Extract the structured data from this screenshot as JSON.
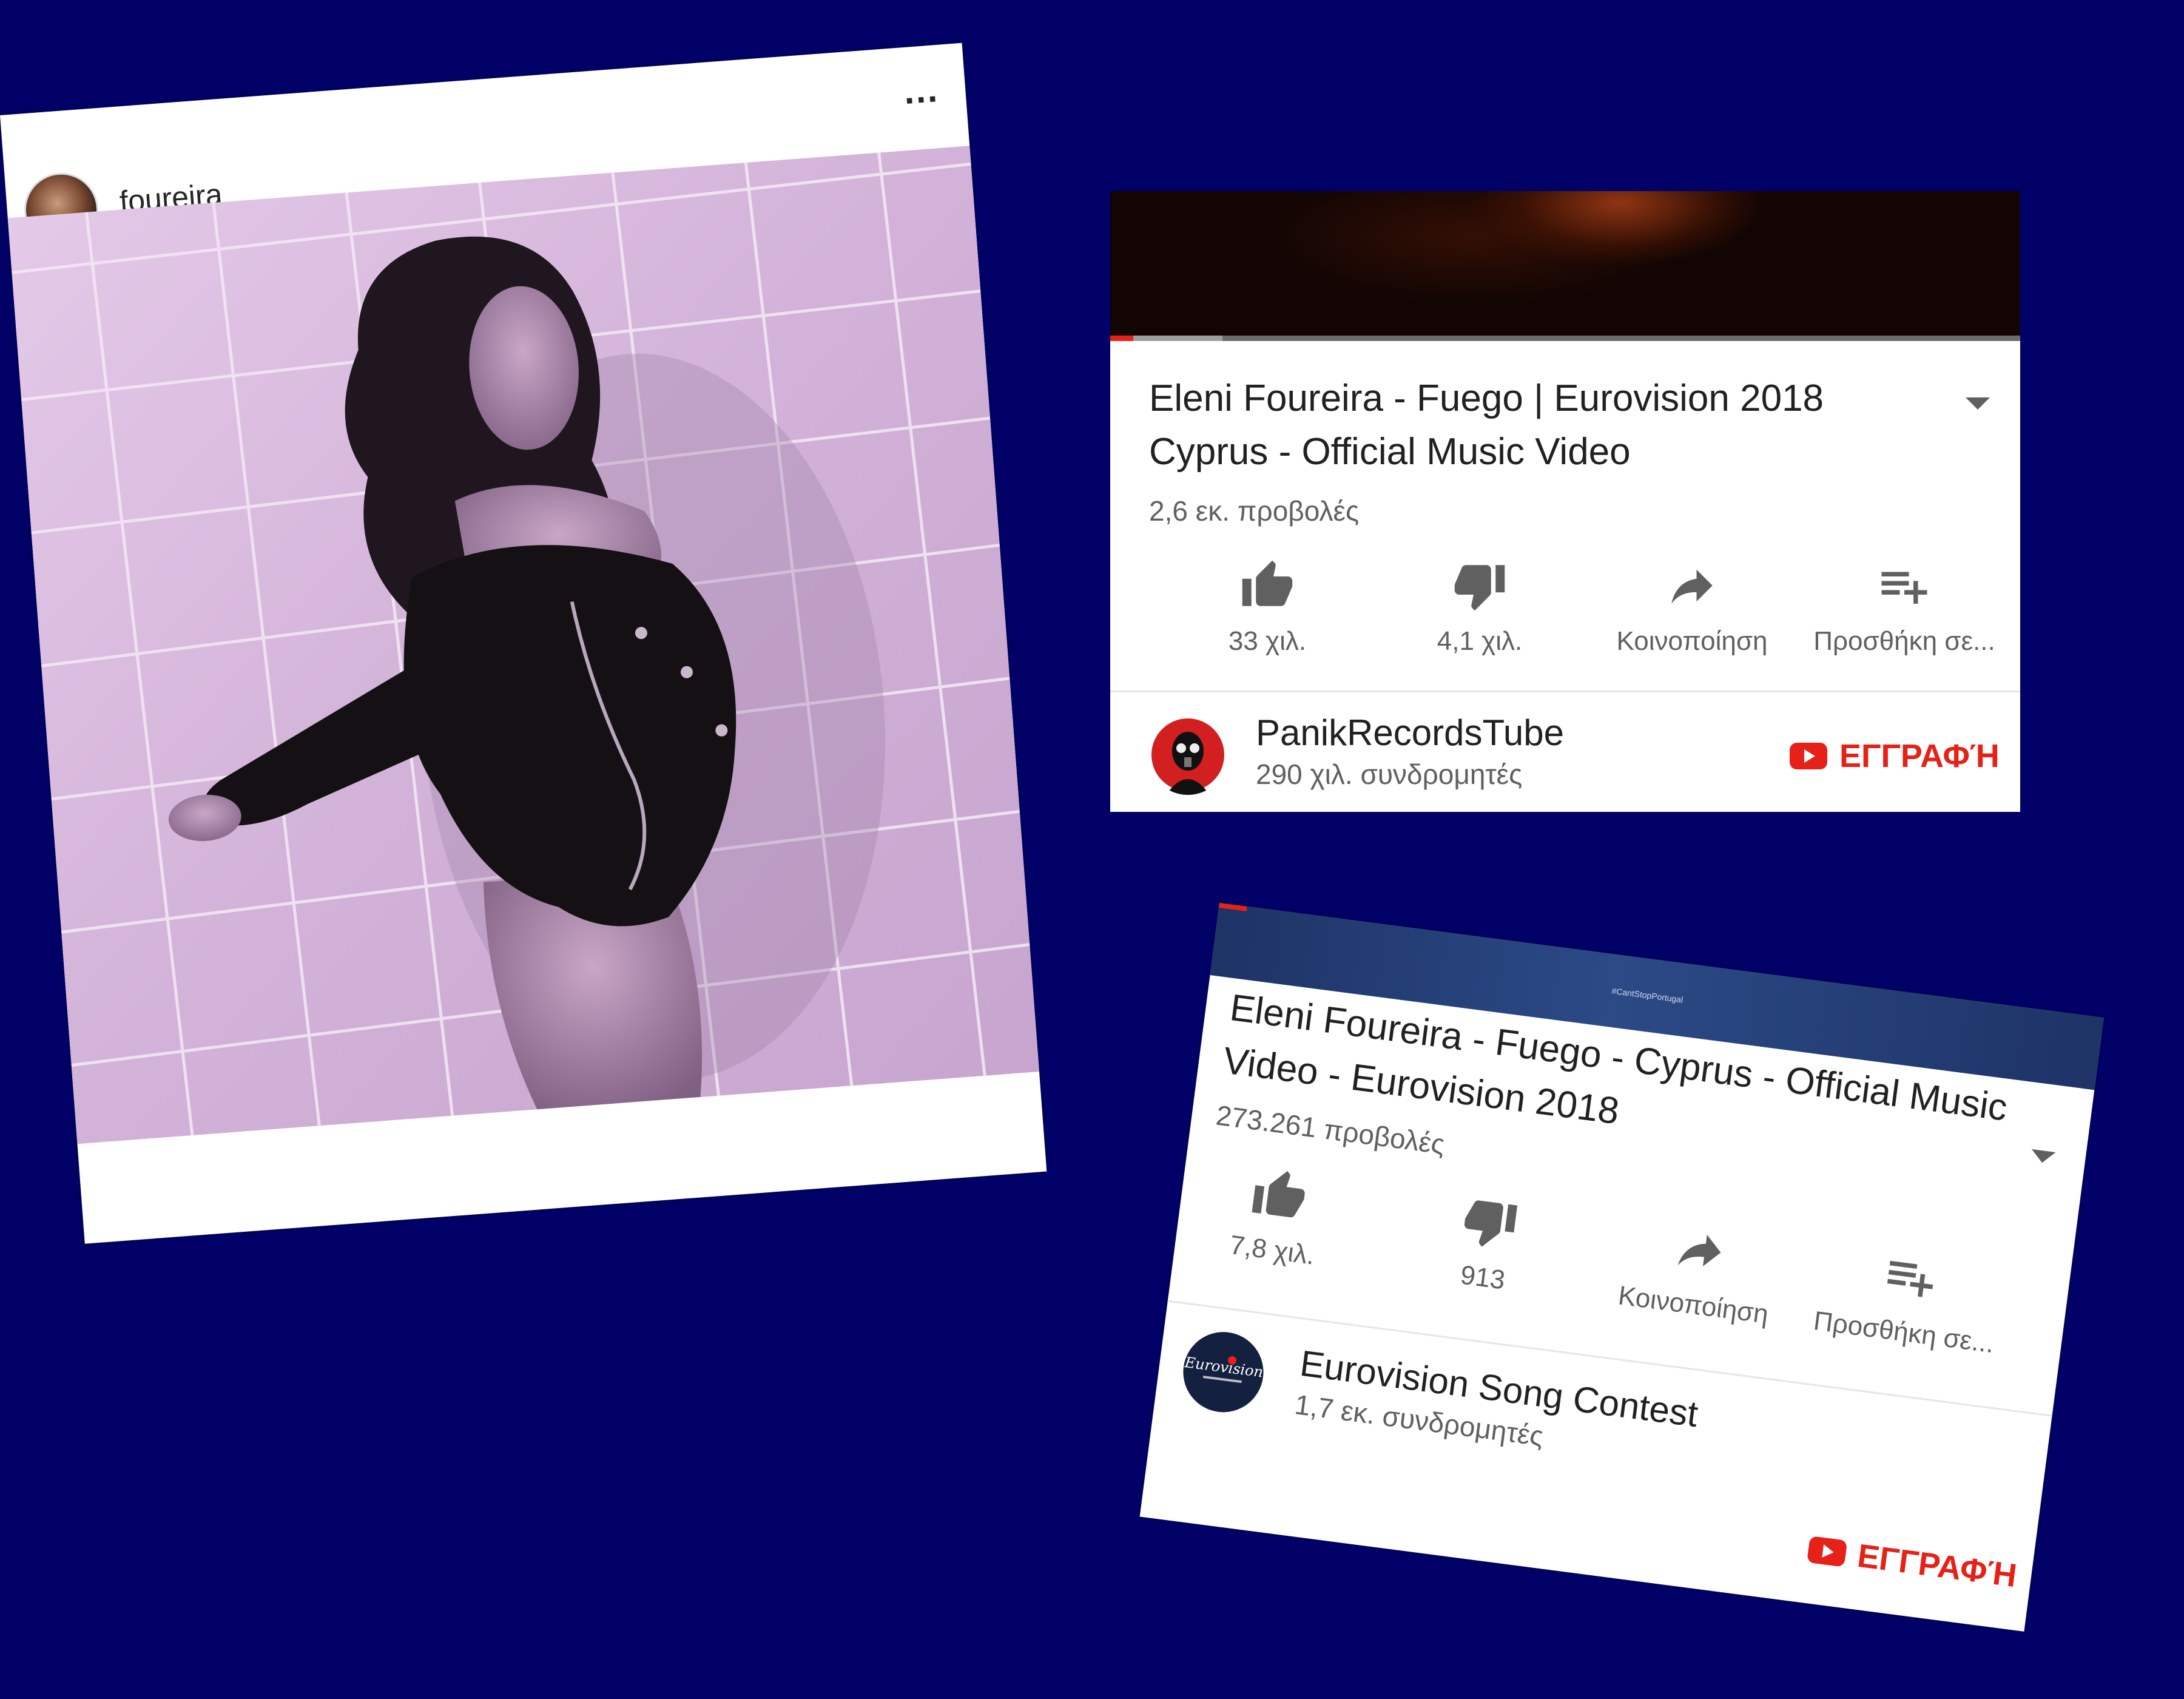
{
  "colors": {
    "background": "#000066",
    "youtube_red": "#e62117",
    "instagram_text": "#262626",
    "muted_text": "#606060"
  },
  "instagram": {
    "username": "foureira",
    "more_icon": "…",
    "icons": {
      "avatar": "profile-avatar",
      "more": "more-options-icon"
    }
  },
  "youtube_1": {
    "title_line1": "Eleni Foureira - Fuego | Eurovision 2018",
    "title_line2": "Cyprus - Official Music Video",
    "views": "2,6 εκ. προβολές",
    "likes": "33 χιλ.",
    "dislikes": "4,1 χιλ.",
    "share_label": "Κοινοποίηση",
    "add_label": "Προσθήκη σε...",
    "channel_name": "PanikRecordsTube",
    "channel_subs": "290 χιλ. συνδρομητές",
    "subscribe_label": "ΕΓΓΡΑΦΉ"
  },
  "youtube_2": {
    "title_line1": "Eleni Foureira - Fuego - Cyprus - Official Music",
    "title_line2": "Video - Eurovision 2018",
    "views": "273.261 προβολές",
    "likes": "7,8 χιλ.",
    "dislikes": "913",
    "share_label": "Κοινοποίηση",
    "add_label": "Προσθήκη σε...",
    "channel_name": "Eurovision Song Contest",
    "channel_subs": "1,7 εκ. συνδρομητές",
    "subscribe_label": "ΕΓΓΡΑΦΉ",
    "video_tag": "#CantStopPortugal",
    "channel_logo_text": "Eurovision"
  }
}
